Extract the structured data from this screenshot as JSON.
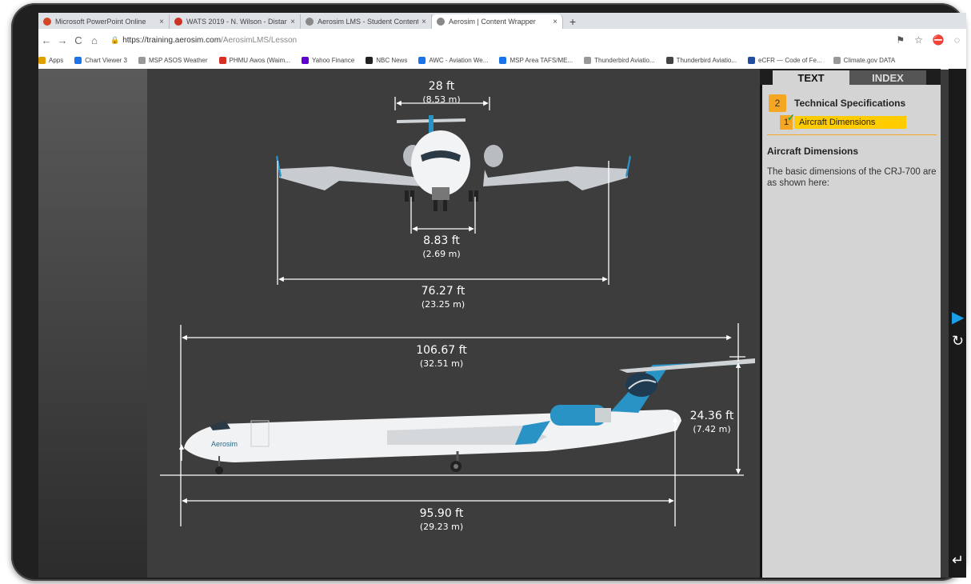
{
  "browser": {
    "tabs": [
      {
        "title": "Microsoft PowerPoint Online",
        "color": "#d24726",
        "active": false
      },
      {
        "title": "WATS 2019 - N. Wilson - Distan...",
        "color": "#cc3322",
        "active": false
      },
      {
        "title": "Aerosim LMS - Student Content",
        "color": "#888888",
        "active": false
      },
      {
        "title": "Aerosim | Content Wrapper",
        "color": "#888888",
        "active": true
      }
    ],
    "newtab": "+",
    "close": "×",
    "url_host": "https://training.aerosim.com",
    "url_path": "/AerosimLMS/Lesson",
    "bookmarks": [
      {
        "label": "Apps",
        "color": "#e0a000"
      },
      {
        "label": "Chart Viewer 3",
        "color": "#1a73e8"
      },
      {
        "label": "MSP ASOS Weather",
        "color": "#999999"
      },
      {
        "label": "PHMU Awos (Waim...",
        "color": "#d93025"
      },
      {
        "label": "Yahoo Finance",
        "color": "#6001d2"
      },
      {
        "label": "NBC News",
        "color": "#222222"
      },
      {
        "label": "AWC - Aviation We...",
        "color": "#1a73e8"
      },
      {
        "label": "MSP Area TAFS/ME...",
        "color": "#1a73e8"
      },
      {
        "label": "Thunderbird Aviatio...",
        "color": "#999999"
      },
      {
        "label": "Thunderbird Aviatio...",
        "color": "#444444"
      },
      {
        "label": "eCFR — Code of Fe...",
        "color": "#1f4fa3"
      },
      {
        "label": "Climate.gov DATA",
        "color": "#999999"
      }
    ]
  },
  "diagram": {
    "brand": "Aerosim",
    "dims": {
      "tail_span_ft": "28 ft",
      "tail_span_m": "(8.53 m)",
      "gear_track_ft": "8.83 ft",
      "gear_track_m": "(2.69 m)",
      "wingspan_ft": "76.27 ft",
      "wingspan_m": "(23.25 m)",
      "length_ft": "106.67 ft",
      "length_m": "(32.51 m)",
      "height_ft": "24.36 ft",
      "height_m": "(7.42 m)",
      "wheelbase_ft": "95.90 ft",
      "wheelbase_m": "(29.23 m)"
    }
  },
  "sidebar": {
    "tab_text": "TEXT",
    "tab_index": "INDEX",
    "section_num": "2",
    "section_title": "Technical Specifications",
    "item_num": "1",
    "item_title": "Aircraft Dimensions",
    "content_heading": "Aircraft Dimensions",
    "content_body": "The basic dimensions of the CRJ-700 are as shown here:"
  },
  "colors": {
    "accent": "#f5a623",
    "highlight": "#ffcc00",
    "livery": "#2a93c6"
  }
}
